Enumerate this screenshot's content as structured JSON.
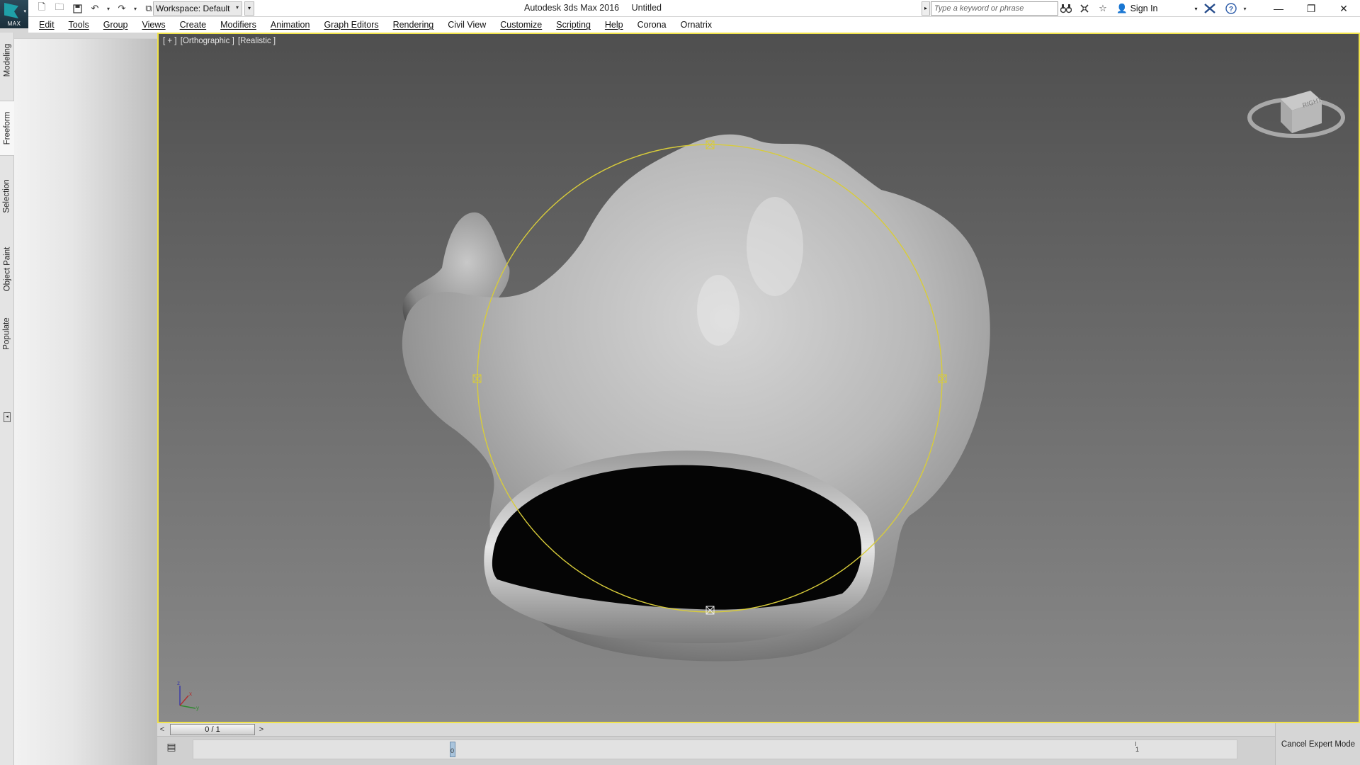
{
  "app": {
    "logo_caption": "MAX",
    "title": "Autodesk 3ds Max 2016",
    "document": "Untitled"
  },
  "quick_access": {
    "workspace_label": "Workspace: Default",
    "icons": [
      "new-file-icon",
      "open-folder-icon",
      "save-icon",
      "undo-icon",
      "redo-icon",
      "project-folder-icon"
    ]
  },
  "search": {
    "placeholder": "Type a keyword or phrase"
  },
  "infocenter": {
    "sign_in": "Sign In"
  },
  "menu": {
    "items": [
      "Edit",
      "Tools",
      "Group",
      "Views",
      "Create",
      "Modifiers",
      "Animation",
      "Graph Editors",
      "Rendering",
      "Civil View",
      "Customize",
      "Scripting",
      "Help",
      "Corona",
      "Ornatrix"
    ]
  },
  "ribbon_tabs": [
    "Modeling",
    "Freeform",
    "Selection",
    "Object Paint",
    "Populate"
  ],
  "ribbon_active_tab": "Freeform",
  "viewport": {
    "label_plus": "[ + ]",
    "label_view": "[Orthographic ]",
    "label_shading": "[Realistic ]",
    "viewcube_face": "RIGHT",
    "border_color": "#f1e34a"
  },
  "time_slider": {
    "value": "0 / 1",
    "prev": "<",
    "next": ">"
  },
  "track_bar": {
    "start_label": "0",
    "end_label": "1"
  },
  "expert_mode": {
    "cancel_label": "Cancel Expert Mode"
  }
}
